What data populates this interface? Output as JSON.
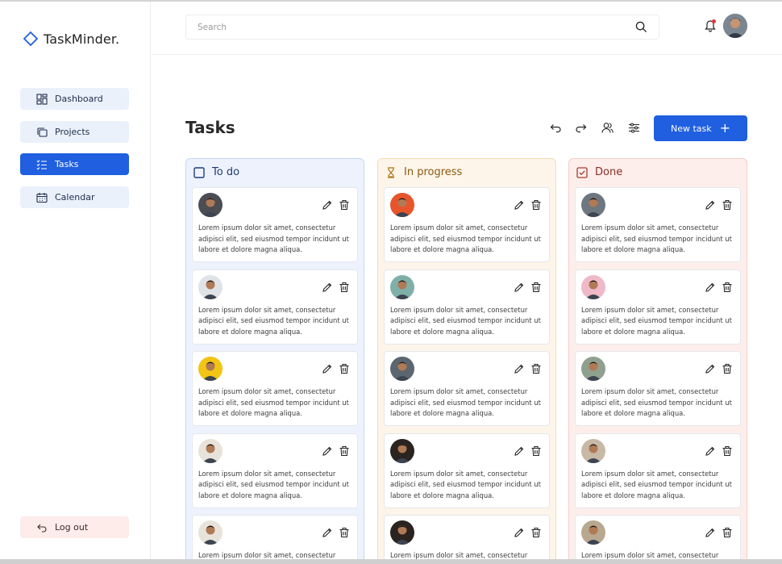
{
  "app": {
    "name": "TaskMinder."
  },
  "sidebar": {
    "items": [
      {
        "label": "Dashboard",
        "icon": "dashboard-icon"
      },
      {
        "label": "Projects",
        "icon": "projects-icon"
      },
      {
        "label": "Tasks",
        "icon": "tasks-icon",
        "active": true
      },
      {
        "label": "Calendar",
        "icon": "calendar-icon"
      }
    ],
    "logout_label": "Log out"
  },
  "topbar": {
    "search_placeholder": "Search"
  },
  "page": {
    "title": "Tasks",
    "new_task_label": "New task",
    "new_task_icon": "+"
  },
  "colors": {
    "accent": "#1f5fe0",
    "todo_bg": "#edf2fd",
    "progress_bg": "#fdf5e9",
    "done_bg": "#fdeeec"
  },
  "columns": [
    {
      "key": "todo",
      "title": "To do",
      "cards": [
        {
          "text": "Lorem ipsum dolor sit amet, consectetur adipisci elit, sed eiusmod tempor incidunt ut labore et dolore magna aliqua.",
          "avatar_bg": "#4a4d52"
        },
        {
          "text": "Lorem ipsum dolor sit amet, consectetur adipisci elit, sed eiusmod tempor incidunt ut labore et dolore magna aliqua.",
          "avatar_bg": "#dfe3e8"
        },
        {
          "text": "Lorem ipsum dolor sit amet, consectetur adipisci elit, sed eiusmod tempor incidunt ut labore et dolore magna aliqua.",
          "avatar_bg": "#f2c413"
        },
        {
          "text": "Lorem ipsum dolor sit amet, consectetur adipisci elit, sed eiusmod tempor incidunt ut labore et dolore magna aliqua.",
          "avatar_bg": "#e8e3da"
        },
        {
          "text": "Lorem ipsum dolor sit amet, consectetur",
          "avatar_bg": "#e8e3da"
        }
      ]
    },
    {
      "key": "progress",
      "title": "In progress",
      "cards": [
        {
          "text": "Lorem ipsum dolor sit amet, consectetur adipisci elit, sed eiusmod tempor incidunt ut labore et dolore magna aliqua.",
          "avatar_bg": "#e8552b"
        },
        {
          "text": "Lorem ipsum dolor sit amet, consectetur adipisci elit, sed eiusmod tempor incidunt ut labore et dolore magna aliqua.",
          "avatar_bg": "#7fb0a8"
        },
        {
          "text": "Lorem ipsum dolor sit amet, consectetur adipisci elit, sed eiusmod tempor incidunt ut labore et dolore magna aliqua.",
          "avatar_bg": "#5b6670"
        },
        {
          "text": "Lorem ipsum dolor sit amet, consectetur adipisci elit, sed eiusmod tempor incidunt ut labore et dolore magna aliqua.",
          "avatar_bg": "#2a2320"
        },
        {
          "text": "Lorem ipsum dolor sit amet, consectetur",
          "avatar_bg": "#2a2320"
        }
      ]
    },
    {
      "key": "done",
      "title": "Done",
      "cards": [
        {
          "text": "Lorem ipsum dolor sit amet, consectetur adipisci elit, sed eiusmod tempor incidunt ut labore et dolore magna aliqua.",
          "avatar_bg": "#6e7780"
        },
        {
          "text": "Lorem ipsum dolor sit amet, consectetur adipisci elit, sed eiusmod tempor incidunt ut labore et dolore magna aliqua.",
          "avatar_bg": "#f0b9c8"
        },
        {
          "text": "Lorem ipsum dolor sit amet, consectetur adipisci elit, sed eiusmod tempor incidunt ut labore et dolore magna aliqua.",
          "avatar_bg": "#8fa08e"
        },
        {
          "text": "Lorem ipsum dolor sit amet, consectetur adipisci elit, sed eiusmod tempor incidunt ut labore et dolore magna aliqua.",
          "avatar_bg": "#c7b9a6"
        },
        {
          "text": "Lorem ipsum dolor sit amet, consectetur",
          "avatar_bg": "#b8a890"
        }
      ]
    }
  ]
}
